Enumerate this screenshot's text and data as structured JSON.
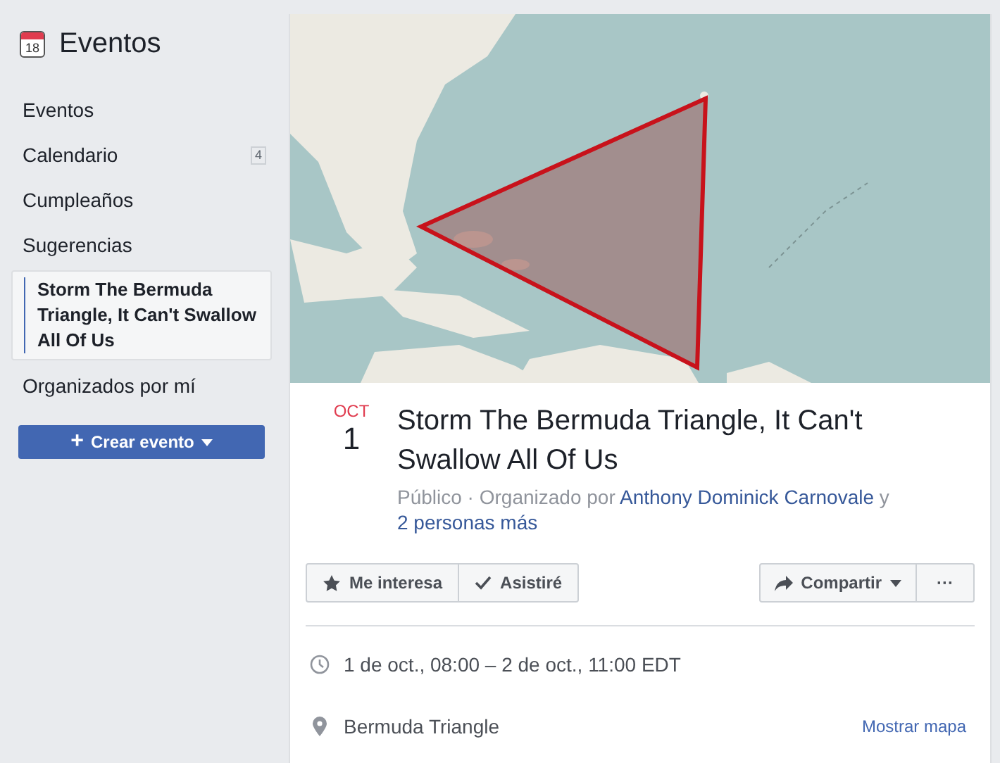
{
  "header": {
    "icon_day": "18",
    "title": "Eventos"
  },
  "sidebar": {
    "items": [
      {
        "label": "Eventos",
        "selected": false
      },
      {
        "label": "Calendario",
        "selected": false,
        "count": "4"
      },
      {
        "label": "Cumpleaños",
        "selected": false
      },
      {
        "label": "Sugerencias",
        "selected": false
      },
      {
        "label": "Storm The Bermuda Triangle, It Can't Swallow All Of Us",
        "selected": true
      },
      {
        "label": "Organizados por mí",
        "selected": false
      }
    ],
    "create_button": {
      "icon": "+",
      "label": "Crear evento"
    }
  },
  "event": {
    "month": "OCT",
    "day": "1",
    "title": "Storm The Bermuda Triangle, It Can't Swallow All Of Us",
    "meta": {
      "privacy": "Público",
      "separator": " · ",
      "organized_by": "Organizado por ",
      "organizer": "Anthony Dominick Carnovale",
      "joiner": " y ",
      "others": "2 personas más"
    },
    "actions": [
      {
        "kind": "star",
        "label": "Me interesa"
      },
      {
        "kind": "check",
        "label": "Asistiré"
      }
    ],
    "share": {
      "label": "Compartir"
    },
    "more": {
      "label": "···"
    },
    "details": [
      {
        "kind": "time",
        "text": "1 de oct., 08:00 – 2 de oct., 11:00 EDT"
      },
      {
        "kind": "place",
        "text": "Bermuda Triangle",
        "link": "Mostrar mapa"
      }
    ]
  }
}
